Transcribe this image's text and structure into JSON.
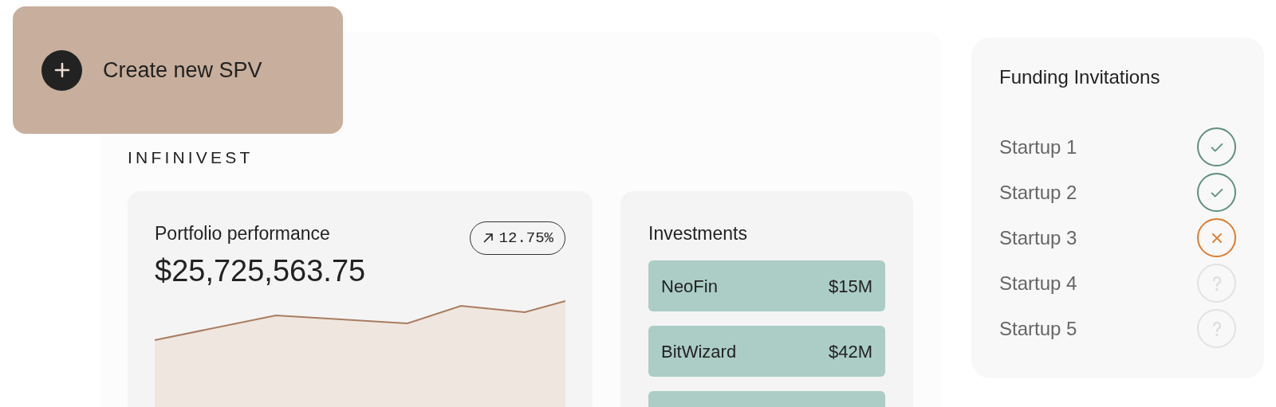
{
  "create_button": {
    "label": "Create new SPV"
  },
  "brand": "INFINIVEST",
  "portfolio": {
    "title": "Portfolio performance",
    "value": "$25,725,563.75",
    "change": "12.75%"
  },
  "investments": {
    "title": "Investments",
    "items": [
      {
        "kind": "entry",
        "name": "NeoFin",
        "amount": "$15M"
      },
      {
        "kind": "entry",
        "name": "BitWizard",
        "amount": "$42M"
      },
      {
        "kind": "blank"
      }
    ]
  },
  "funding_invitations": {
    "title": "Funding Invitations",
    "items": [
      {
        "name": "Startup 1",
        "kind": "accepted"
      },
      {
        "name": "Startup 2",
        "kind": "accepted"
      },
      {
        "name": "Startup 3",
        "kind": "declined"
      },
      {
        "name": "Startup 4",
        "kind": "pending"
      },
      {
        "name": "Startup 5",
        "kind": "pending"
      }
    ]
  }
}
